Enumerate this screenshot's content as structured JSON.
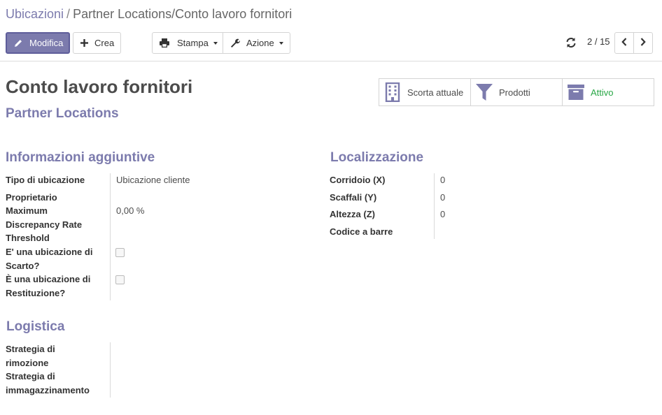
{
  "breadcrumb": {
    "parent": "Ubicazioni",
    "separator": "/",
    "current": "Partner Locations/Conto lavoro fornitori"
  },
  "toolbar": {
    "edit_label": "Modifica",
    "create_label": "Crea",
    "print_label": "Stampa",
    "action_label": "Azione"
  },
  "pager": {
    "value": "2 / 15"
  },
  "record": {
    "name": "Conto lavoro fornitori",
    "parent_location": "Partner Locations"
  },
  "smart_buttons": [
    {
      "icon": "building-icon",
      "label": "Scorta attuale"
    },
    {
      "icon": "filter-icon",
      "label": "Prodotti"
    },
    {
      "icon": "archive-icon",
      "label": "Attivo"
    }
  ],
  "sections": {
    "additional_info": {
      "title": "Informazioni aggiuntive",
      "location_type_label": "Tipo di ubicazione",
      "location_type_value": "Ubicazione cliente",
      "owner_label": "Proprietario",
      "max_discrepancy_label": "Maximum Discrepancy Rate Threshold",
      "max_discrepancy_value": "0,00 %",
      "scrap_label": "E' una ubicazione di Scarto?",
      "scrap_checked": false,
      "return_label": "È una ubicazione di Restituzione?",
      "return_checked": false
    },
    "localization": {
      "title": "Localizzazione",
      "corridor_label": "Corridoio (X)",
      "corridor_value": "0",
      "shelves_label": "Scaffali (Y)",
      "shelves_value": "0",
      "height_label": "Altezza (Z)",
      "height_value": "0",
      "barcode_label": "Codice a barre"
    },
    "logistics": {
      "title": "Logistica",
      "removal_label": "Strategia di rimozione",
      "putaway_label": "Strategia di immagazzinamento"
    }
  },
  "colors": {
    "brand": "#7c7bad",
    "active": "#28a745"
  }
}
